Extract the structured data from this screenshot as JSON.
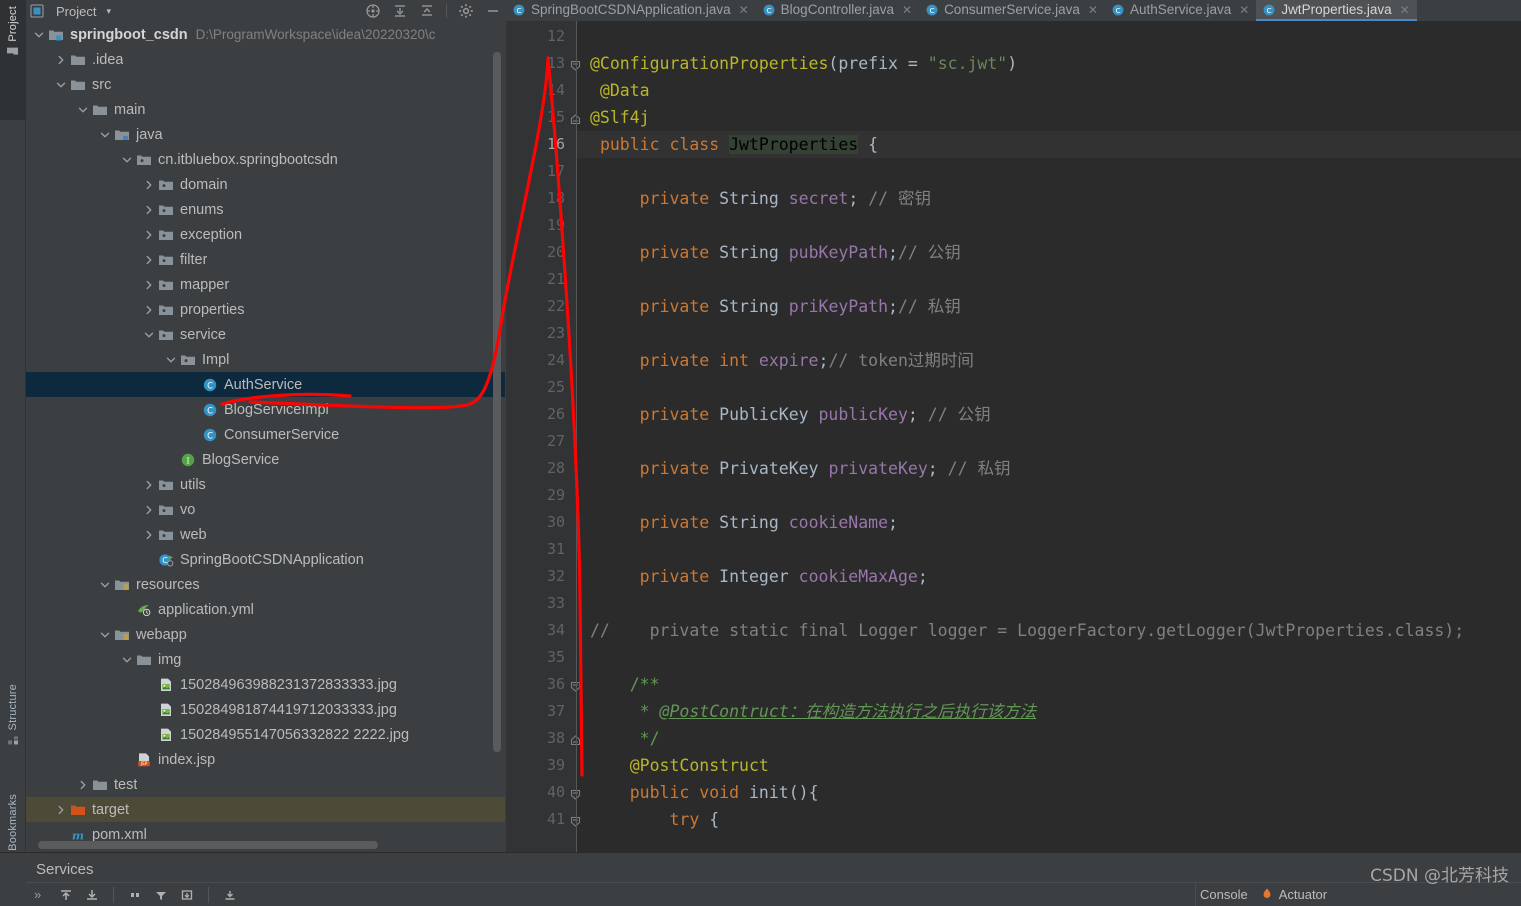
{
  "toolwindow_tabs": [
    {
      "label": "Project",
      "icon": "project-icon",
      "active": true
    },
    {
      "label": "Structure",
      "icon": "structure-icon",
      "active": false
    },
    {
      "label": "Bookmarks",
      "icon": "bookmark-icon",
      "active": false
    }
  ],
  "project_panel": {
    "title": "Project",
    "caret": "▾",
    "toolbar": [
      {
        "name": "locate-file-icon",
        "tooltip": "Select Opened File"
      },
      {
        "name": "expand-all-icon",
        "tooltip": "Expand All"
      },
      {
        "name": "collapse-all-icon",
        "tooltip": "Collapse All"
      },
      {
        "name": "settings-gear-icon",
        "tooltip": "Options"
      },
      {
        "name": "hide-icon",
        "tooltip": "Hide"
      }
    ],
    "tree": [
      {
        "label": "springboot_csdn",
        "path": "D:\\ProgramWorkspace\\idea\\20220320\\c",
        "depth": 0,
        "arrow": "down",
        "icon": "module-folder-icon",
        "bold": true
      },
      {
        "label": ".idea",
        "depth": 1,
        "arrow": "right",
        "icon": "folder-icon"
      },
      {
        "label": "src",
        "depth": 1,
        "arrow": "down",
        "icon": "folder-icon"
      },
      {
        "label": "main",
        "depth": 2,
        "arrow": "down",
        "icon": "folder-icon"
      },
      {
        "label": "java",
        "depth": 3,
        "arrow": "down",
        "icon": "source-folder-icon"
      },
      {
        "label": "cn.itbluebox.springbootcsdn",
        "depth": 4,
        "arrow": "down",
        "icon": "package-icon"
      },
      {
        "label": "domain",
        "depth": 5,
        "arrow": "right",
        "icon": "package-icon"
      },
      {
        "label": "enums",
        "depth": 5,
        "arrow": "right",
        "icon": "package-icon"
      },
      {
        "label": "exception",
        "depth": 5,
        "arrow": "right",
        "icon": "package-icon"
      },
      {
        "label": "filter",
        "depth": 5,
        "arrow": "right",
        "icon": "package-icon"
      },
      {
        "label": "mapper",
        "depth": 5,
        "arrow": "right",
        "icon": "package-icon"
      },
      {
        "label": "properties",
        "depth": 5,
        "arrow": "right",
        "icon": "package-icon"
      },
      {
        "label": "service",
        "depth": 5,
        "arrow": "down",
        "icon": "package-icon"
      },
      {
        "label": "Impl",
        "depth": 6,
        "arrow": "down",
        "icon": "package-icon"
      },
      {
        "label": "AuthService",
        "depth": 7,
        "arrow": "none",
        "icon": "java-class-icon",
        "selected": true
      },
      {
        "label": "BlogServiceImpl",
        "depth": 7,
        "arrow": "none",
        "icon": "java-class-icon"
      },
      {
        "label": "ConsumerService",
        "depth": 7,
        "arrow": "none",
        "icon": "java-class-icon"
      },
      {
        "label": "BlogService",
        "depth": 6,
        "arrow": "none",
        "icon": "java-interface-icon"
      },
      {
        "label": "utils",
        "depth": 5,
        "arrow": "right",
        "icon": "package-icon"
      },
      {
        "label": "vo",
        "depth": 5,
        "arrow": "right",
        "icon": "package-icon"
      },
      {
        "label": "web",
        "depth": 5,
        "arrow": "right",
        "icon": "package-icon"
      },
      {
        "label": "SpringBootCSDNApplication",
        "depth": 5,
        "arrow": "none",
        "icon": "spring-boot-class-icon"
      },
      {
        "label": "resources",
        "depth": 3,
        "arrow": "down",
        "icon": "resources-folder-icon"
      },
      {
        "label": "application.yml",
        "depth": 4,
        "arrow": "none",
        "icon": "spring-yaml-icon"
      },
      {
        "label": "webapp",
        "depth": 3,
        "arrow": "down",
        "icon": "resources-folder-icon"
      },
      {
        "label": "img",
        "depth": 4,
        "arrow": "down",
        "icon": "folder-icon"
      },
      {
        "label": "150284963988231372833333.jpg",
        "depth": 5,
        "arrow": "none",
        "icon": "image-file-icon"
      },
      {
        "label": "150284981874419712033333.jpg",
        "depth": 5,
        "arrow": "none",
        "icon": "image-file-icon"
      },
      {
        "label": "150284955147056332822 2222.jpg",
        "depth": 5,
        "arrow": "none",
        "icon": "image-file-icon"
      },
      {
        "label": "index.jsp",
        "depth": 4,
        "arrow": "none",
        "icon": "jsp-file-icon"
      },
      {
        "label": "test",
        "depth": 2,
        "arrow": "right",
        "icon": "folder-icon"
      },
      {
        "label": "target",
        "depth": 1,
        "arrow": "right",
        "icon": "excluded-folder-icon",
        "hovered": true
      },
      {
        "label": "pom.xml",
        "depth": 1,
        "arrow": "none",
        "icon": "maven-file-icon"
      }
    ]
  },
  "editor": {
    "tabs": [
      {
        "label": "SpringBootCSDNApplication.java",
        "icon": "java-class-icon",
        "active": false,
        "closable": true
      },
      {
        "label": "BlogController.java",
        "icon": "java-class-icon",
        "active": false,
        "closable": true
      },
      {
        "label": "ConsumerService.java",
        "icon": "java-class-icon",
        "active": false,
        "closable": true
      },
      {
        "label": "AuthService.java",
        "icon": "java-class-icon",
        "active": false,
        "closable": true
      },
      {
        "label": "JwtProperties.java",
        "icon": "java-class-icon",
        "active": true,
        "closable": true
      }
    ],
    "first_line_number": 12,
    "current_line": 16,
    "lines": [
      {
        "n": 12,
        "tokens": []
      },
      {
        "n": 13,
        "fold": "start",
        "tokens": [
          {
            "t": "@ConfigurationProperties",
            "c": "ann"
          },
          {
            "t": "(prefix = ",
            "c": "pln"
          },
          {
            "t": "\"sc.jwt\"",
            "c": "str"
          },
          {
            "t": ")",
            "c": "pln"
          }
        ]
      },
      {
        "n": 14,
        "tokens": [
          {
            "t": " @Data",
            "c": "ann"
          }
        ]
      },
      {
        "n": 15,
        "fold": "end",
        "tokens": [
          {
            "t": "@Slf4j",
            "c": "ann"
          }
        ]
      },
      {
        "n": 16,
        "current": true,
        "tokens": [
          {
            "t": " ",
            "c": "pln"
          },
          {
            "t": "public class ",
            "c": "kw"
          },
          {
            "t": "JwtProperties",
            "c": "sel-ident"
          },
          {
            "t": " {",
            "c": "pln"
          }
        ]
      },
      {
        "n": 17,
        "tokens": []
      },
      {
        "n": 18,
        "tokens": [
          {
            "t": "     ",
            "c": "pln"
          },
          {
            "t": "private ",
            "c": "kw"
          },
          {
            "t": "String ",
            "c": "typ"
          },
          {
            "t": "secret",
            "c": "fld"
          },
          {
            "t": "; ",
            "c": "pln"
          },
          {
            "t": "// 密钥",
            "c": "cmt"
          }
        ]
      },
      {
        "n": 19,
        "tokens": []
      },
      {
        "n": 20,
        "tokens": [
          {
            "t": "     ",
            "c": "pln"
          },
          {
            "t": "private ",
            "c": "kw"
          },
          {
            "t": "String ",
            "c": "typ"
          },
          {
            "t": "pubKeyPath",
            "c": "fld"
          },
          {
            "t": ";",
            "c": "pln"
          },
          {
            "t": "// 公钥",
            "c": "cmt"
          }
        ]
      },
      {
        "n": 21,
        "tokens": []
      },
      {
        "n": 22,
        "tokens": [
          {
            "t": "     ",
            "c": "pln"
          },
          {
            "t": "private ",
            "c": "kw"
          },
          {
            "t": "String ",
            "c": "typ"
          },
          {
            "t": "priKeyPath",
            "c": "fld"
          },
          {
            "t": ";",
            "c": "pln"
          },
          {
            "t": "// 私钥",
            "c": "cmt"
          }
        ]
      },
      {
        "n": 23,
        "tokens": []
      },
      {
        "n": 24,
        "tokens": [
          {
            "t": "     ",
            "c": "pln"
          },
          {
            "t": "private int ",
            "c": "kw"
          },
          {
            "t": "expire",
            "c": "fld"
          },
          {
            "t": ";",
            "c": "pln"
          },
          {
            "t": "// token过期时间",
            "c": "cmt"
          }
        ]
      },
      {
        "n": 25,
        "tokens": []
      },
      {
        "n": 26,
        "tokens": [
          {
            "t": "     ",
            "c": "pln"
          },
          {
            "t": "private ",
            "c": "kw"
          },
          {
            "t": "PublicKey ",
            "c": "typ"
          },
          {
            "t": "publicKey",
            "c": "fld"
          },
          {
            "t": "; ",
            "c": "pln"
          },
          {
            "t": "// 公钥",
            "c": "cmt"
          }
        ]
      },
      {
        "n": 27,
        "tokens": []
      },
      {
        "n": 28,
        "tokens": [
          {
            "t": "     ",
            "c": "pln"
          },
          {
            "t": "private ",
            "c": "kw"
          },
          {
            "t": "PrivateKey ",
            "c": "typ"
          },
          {
            "t": "privateKey",
            "c": "fld"
          },
          {
            "t": "; ",
            "c": "pln"
          },
          {
            "t": "// 私钥",
            "c": "cmt"
          }
        ]
      },
      {
        "n": 29,
        "tokens": []
      },
      {
        "n": 30,
        "tokens": [
          {
            "t": "     ",
            "c": "pln"
          },
          {
            "t": "private ",
            "c": "kw"
          },
          {
            "t": "String ",
            "c": "typ"
          },
          {
            "t": "cookieName",
            "c": "fld"
          },
          {
            "t": ";",
            "c": "pln"
          }
        ]
      },
      {
        "n": 31,
        "tokens": []
      },
      {
        "n": 32,
        "tokens": [
          {
            "t": "     ",
            "c": "pln"
          },
          {
            "t": "private ",
            "c": "kw"
          },
          {
            "t": "Integer ",
            "c": "typ"
          },
          {
            "t": "cookieMaxAge",
            "c": "fld"
          },
          {
            "t": ";",
            "c": "pln"
          }
        ]
      },
      {
        "n": 33,
        "tokens": []
      },
      {
        "n": 34,
        "tokens": [
          {
            "t": "//    private static final Logger logger = LoggerFactory.getLogger(JwtProperties.class);",
            "c": "cmt"
          }
        ]
      },
      {
        "n": 35,
        "tokens": []
      },
      {
        "n": 36,
        "fold": "start",
        "tokens": [
          {
            "t": "    ",
            "c": "pln"
          },
          {
            "t": "/**",
            "c": "doc"
          }
        ]
      },
      {
        "n": 37,
        "tokens": [
          {
            "t": "     * ",
            "c": "doc"
          },
          {
            "t": "@PostContruct：在构造方法执行之后执行该方法",
            "c": "doclink"
          }
        ]
      },
      {
        "n": 38,
        "fold": "end",
        "tokens": [
          {
            "t": "     */",
            "c": "doc"
          }
        ]
      },
      {
        "n": 39,
        "tokens": [
          {
            "t": "    ",
            "c": "pln"
          },
          {
            "t": "@PostConstruct",
            "c": "ann"
          }
        ]
      },
      {
        "n": 40,
        "fold": "start",
        "tokens": [
          {
            "t": "    ",
            "c": "pln"
          },
          {
            "t": "public void ",
            "c": "kw"
          },
          {
            "t": "init",
            "c": "typ"
          },
          {
            "t": "(){",
            "c": "pln"
          }
        ]
      },
      {
        "n": 41,
        "fold": "start",
        "tokens": [
          {
            "t": "        ",
            "c": "pln"
          },
          {
            "t": "try ",
            "c": "kw"
          },
          {
            "t": "{",
            "c": "pln"
          }
        ]
      }
    ]
  },
  "bottom": {
    "services_title": "Services",
    "expand_chevron": "»",
    "toolbar_buttons": [
      {
        "name": "scroll-to-top-icon"
      },
      {
        "name": "scroll-to-end-icon"
      },
      {
        "name": "pause-icon"
      },
      {
        "name": "filter-icon"
      },
      {
        "name": "export-icon"
      },
      {
        "name": "print-icon"
      }
    ],
    "right_tabs": [
      {
        "label": "Console",
        "icon": "console-icon"
      },
      {
        "label": "Actuator",
        "icon": "actuator-icon"
      }
    ]
  },
  "watermark": "CSDN @北芳科技",
  "colors": {
    "editor_bg": "#2b2b2b",
    "panel_bg": "#3c3f41",
    "gutter_bg": "#313335",
    "selection_bg": "#0d293e",
    "hover_bg": "#4e4a38",
    "active_tab_underline": "#4a88c7",
    "annotation_red": "#ff0000",
    "keyword": "#cc7832",
    "annotation_yellow": "#bbb529",
    "string": "#6a8759",
    "field": "#9876aa",
    "comment": "#808080",
    "javadoc": "#629755",
    "plain": "#a9b7c6"
  }
}
